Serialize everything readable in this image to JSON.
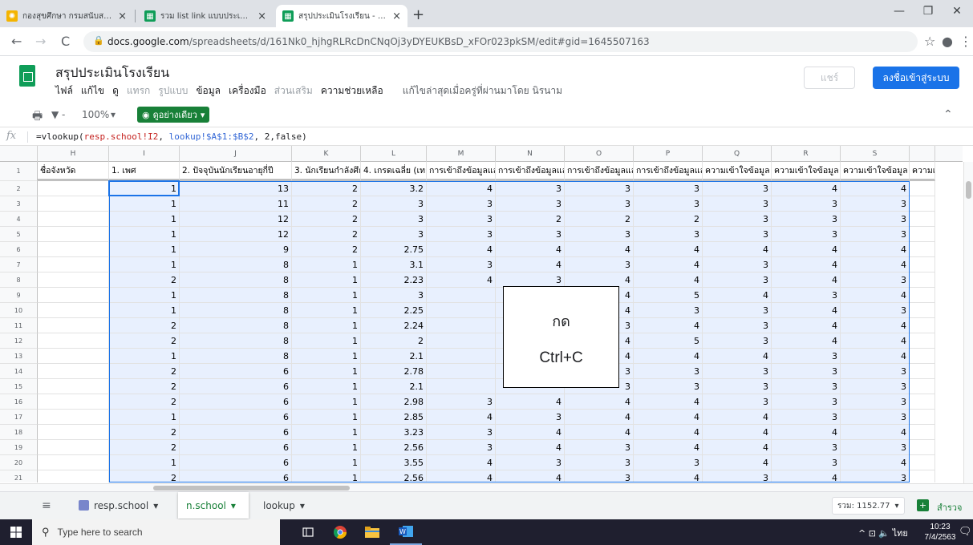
{
  "browser": {
    "tabs": [
      {
        "title": "กองสุขศึกษา กรมสนับสนุนบริการสุขภาพ",
        "close": "×"
      },
      {
        "title": "รวม list link แบบประเมิน จังหวัด - Go",
        "close": "×"
      },
      {
        "title": "สรุปประเมินโรงเรียน - Google ชีต",
        "close": "×"
      }
    ],
    "new_tab": "+",
    "window_controls": {
      "minimize": "—",
      "maximize": "❐",
      "close": "✕"
    },
    "nav": {
      "back": "←",
      "forward": "→",
      "reload": "C",
      "star": "☆",
      "profile": "●",
      "menu": "⋮"
    },
    "url_host": "docs.google.com",
    "url_rest": "/spreadsheets/d/161Nk0_hjhgRLRcDnCNqOj3yDYEUKBsD_xFOr023pkSM/edit#gid=1645507163"
  },
  "doc": {
    "title": "สรุปประเมินโรงเรียน",
    "menus": [
      "ไฟล์",
      "แก้ไข",
      "ดู",
      "แทรก",
      "รูปแบบ",
      "ข้อมูล",
      "เครื่องมือ",
      "ส่วนเสริม",
      "ความช่วยเหลือ"
    ],
    "last_edit": "แก้ไขล่าสุดเมื่อครู่ที่ผ่านมาโดย นิรนาม",
    "share": "แชร์",
    "signin": "ลงชื่อเข้าสู่ระบบ"
  },
  "toolbar": {
    "print": "🖶",
    "filter": "▼ -",
    "zoom": "100%",
    "zoom_caret": "▾",
    "view_only": "ดูอย่างเดียว",
    "view_only_icon": "◉",
    "view_only_caret": "▾",
    "collapse": "⌃"
  },
  "formula_bar": {
    "fx": "fx",
    "p1": "=vlookup(",
    "r1": "resp.school!I2",
    "p2": ", ",
    "r2": "lookup!$A$1:$B$2",
    "p3": ", 2,false)"
  },
  "grid": {
    "columns": [
      "H",
      "I",
      "J",
      "K",
      "L",
      "M",
      "N",
      "O",
      "P",
      "Q",
      "R",
      "S",
      ""
    ],
    "headers": [
      "ชื่อจังหวัด",
      "1. เพศ",
      "2. ปัจจุบันนักเรียนอายุกี่ปี",
      "3. นักเรียนกำลังศึก",
      "4. เกรดเฉลี่ย (เทอ",
      "การเข้าถึงข้อมูลแล",
      "การเข้าถึงข้อมูลแล",
      "การเข้าถึงข้อมูลแล",
      "การเข้าถึงข้อมูลแล",
      "ความเข้าใจข้อมูล",
      "ความเข้าใจข้อมูล",
      "ความเข้าใจข้อมูล",
      "ความเข้"
    ],
    "rows": [
      {
        "n": "2",
        "v": [
          "",
          "1",
          "13",
          "2",
          "3.2",
          "4",
          "3",
          "3",
          "3",
          "3",
          "4",
          "4",
          ""
        ]
      },
      {
        "n": "3",
        "v": [
          "",
          "1",
          "11",
          "2",
          "3",
          "3",
          "3",
          "3",
          "3",
          "3",
          "3",
          "3",
          ""
        ]
      },
      {
        "n": "4",
        "v": [
          "",
          "1",
          "12",
          "2",
          "3",
          "3",
          "2",
          "2",
          "2",
          "3",
          "3",
          "3",
          ""
        ]
      },
      {
        "n": "5",
        "v": [
          "",
          "1",
          "12",
          "2",
          "3",
          "3",
          "3",
          "3",
          "3",
          "3",
          "3",
          "3",
          ""
        ]
      },
      {
        "n": "6",
        "v": [
          "",
          "1",
          "9",
          "2",
          "2.75",
          "4",
          "4",
          "4",
          "4",
          "4",
          "4",
          "4",
          ""
        ]
      },
      {
        "n": "7",
        "v": [
          "",
          "1",
          "8",
          "1",
          "3.1",
          "3",
          "4",
          "3",
          "4",
          "3",
          "4",
          "4",
          ""
        ]
      },
      {
        "n": "8",
        "v": [
          "",
          "2",
          "8",
          "1",
          "2.23",
          "4",
          "3",
          "4",
          "4",
          "3",
          "4",
          "3",
          ""
        ]
      },
      {
        "n": "9",
        "v": [
          "",
          "1",
          "8",
          "1",
          "3",
          "",
          "",
          "4",
          "5",
          "4",
          "3",
          "4",
          ""
        ]
      },
      {
        "n": "10",
        "v": [
          "",
          "1",
          "8",
          "1",
          "2.25",
          "",
          "",
          "4",
          "3",
          "3",
          "4",
          "3",
          ""
        ]
      },
      {
        "n": "11",
        "v": [
          "",
          "2",
          "8",
          "1",
          "2.24",
          "",
          "",
          "3",
          "4",
          "3",
          "4",
          "4",
          ""
        ]
      },
      {
        "n": "12",
        "v": [
          "",
          "2",
          "8",
          "1",
          "2",
          "",
          "",
          "4",
          "5",
          "3",
          "4",
          "4",
          ""
        ]
      },
      {
        "n": "13",
        "v": [
          "",
          "1",
          "8",
          "1",
          "2.1",
          "",
          "",
          "4",
          "4",
          "4",
          "3",
          "4",
          ""
        ]
      },
      {
        "n": "14",
        "v": [
          "",
          "2",
          "6",
          "1",
          "2.78",
          "",
          "",
          "3",
          "3",
          "3",
          "3",
          "3",
          ""
        ]
      },
      {
        "n": "15",
        "v": [
          "",
          "2",
          "6",
          "1",
          "2.1",
          "",
          "",
          "3",
          "3",
          "3",
          "3",
          "3",
          ""
        ]
      },
      {
        "n": "16",
        "v": [
          "",
          "2",
          "6",
          "1",
          "2.98",
          "3",
          "4",
          "4",
          "4",
          "3",
          "3",
          "3",
          ""
        ]
      },
      {
        "n": "17",
        "v": [
          "",
          "1",
          "6",
          "1",
          "2.85",
          "4",
          "3",
          "4",
          "4",
          "4",
          "3",
          "3",
          ""
        ]
      },
      {
        "n": "18",
        "v": [
          "",
          "2",
          "6",
          "1",
          "3.23",
          "3",
          "4",
          "4",
          "4",
          "4",
          "4",
          "4",
          ""
        ]
      },
      {
        "n": "19",
        "v": [
          "",
          "2",
          "6",
          "1",
          "2.56",
          "3",
          "4",
          "3",
          "4",
          "4",
          "3",
          "3",
          ""
        ]
      },
      {
        "n": "20",
        "v": [
          "",
          "1",
          "6",
          "1",
          "3.55",
          "4",
          "3",
          "3",
          "3",
          "4",
          "3",
          "4",
          ""
        ]
      },
      {
        "n": "21",
        "v": [
          "",
          "2",
          "6",
          "1",
          "2.56",
          "4",
          "4",
          "3",
          "4",
          "3",
          "4",
          "3",
          ""
        ]
      }
    ]
  },
  "callout": {
    "line1": "กด",
    "line2": "Ctrl+C"
  },
  "sheets": {
    "all_icon": "≡",
    "tabs": [
      {
        "label": "resp.school",
        "caret": "▾"
      },
      {
        "label": "n.school",
        "caret": "▾"
      },
      {
        "label": "lookup",
        "caret": "▾"
      }
    ],
    "sum": "รวม: 1152.77",
    "sum_caret": "▾",
    "explore_icon": "+",
    "explore": "สำรวจ"
  },
  "taskbar": {
    "search_placeholder": "Type here to search",
    "search_icon": "⚲",
    "tray": "^  ⊡  🔈  ไทย",
    "time": "10:23",
    "date": "7/4/2563",
    "notif": "🗨"
  }
}
